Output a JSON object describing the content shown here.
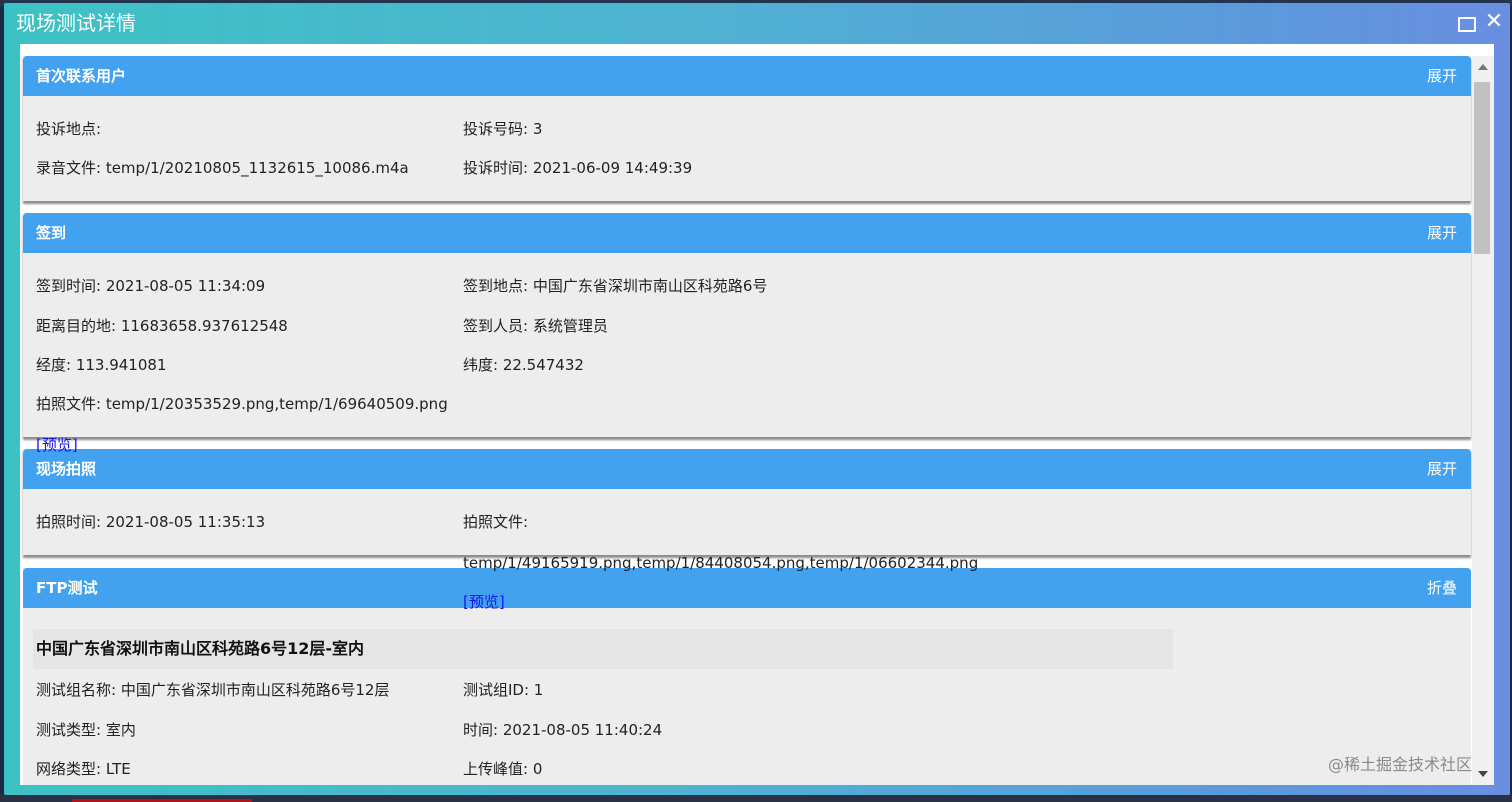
{
  "dialog": {
    "title": "现场测试详情"
  },
  "sections": {
    "first_contact": {
      "title": "首次联系用户",
      "toggle": "展开",
      "complaint_location": "投诉地点:",
      "complaint_number": "投诉号码: 3",
      "recording_file": "录音文件: temp/1/20210805_1132615_10086.m4a",
      "complaint_time": "投诉时间: 2021-06-09 14:49:39"
    },
    "checkin": {
      "title": "签到",
      "toggle": "展开",
      "checkin_time": "签到时间: 2021-08-05 11:34:09",
      "checkin_location": "签到地点: 中国广东省深圳市南山区科苑路6号",
      "distance": "距离目的地: 11683658.937612548",
      "checkin_person": "签到人员: 系统管理员",
      "longitude": "经度: 113.941081",
      "latitude": "纬度: 22.547432",
      "photo_files": "拍照文件: temp/1/20353529.png,temp/1/69640509.png",
      "preview": "[预览]"
    },
    "site_photo": {
      "title": "现场拍照",
      "toggle": "展开",
      "photo_time": "拍照时间: 2021-08-05 11:35:13",
      "photo_files_label": "拍照文件:",
      "photo_files_value": "temp/1/49165919.png,temp/1/84408054.png,temp/1/06602344.png",
      "preview": "[预览]"
    },
    "ftp_test": {
      "title": "FTP测试",
      "toggle": "折叠",
      "location_heading": "中国广东省深圳市南山区科苑路6号12层-室内",
      "group_name": "测试组名称: 中国广东省深圳市南山区科苑路6号12层",
      "group_id": "测试组ID: 1",
      "test_type": "测试类型: 室内",
      "time": "时间: 2021-08-05 11:40:24",
      "network_type": "网络类型: LTE",
      "upload_peak": "上传峰值: 0"
    }
  },
  "watermark": "@稀土掘金技术社区"
}
